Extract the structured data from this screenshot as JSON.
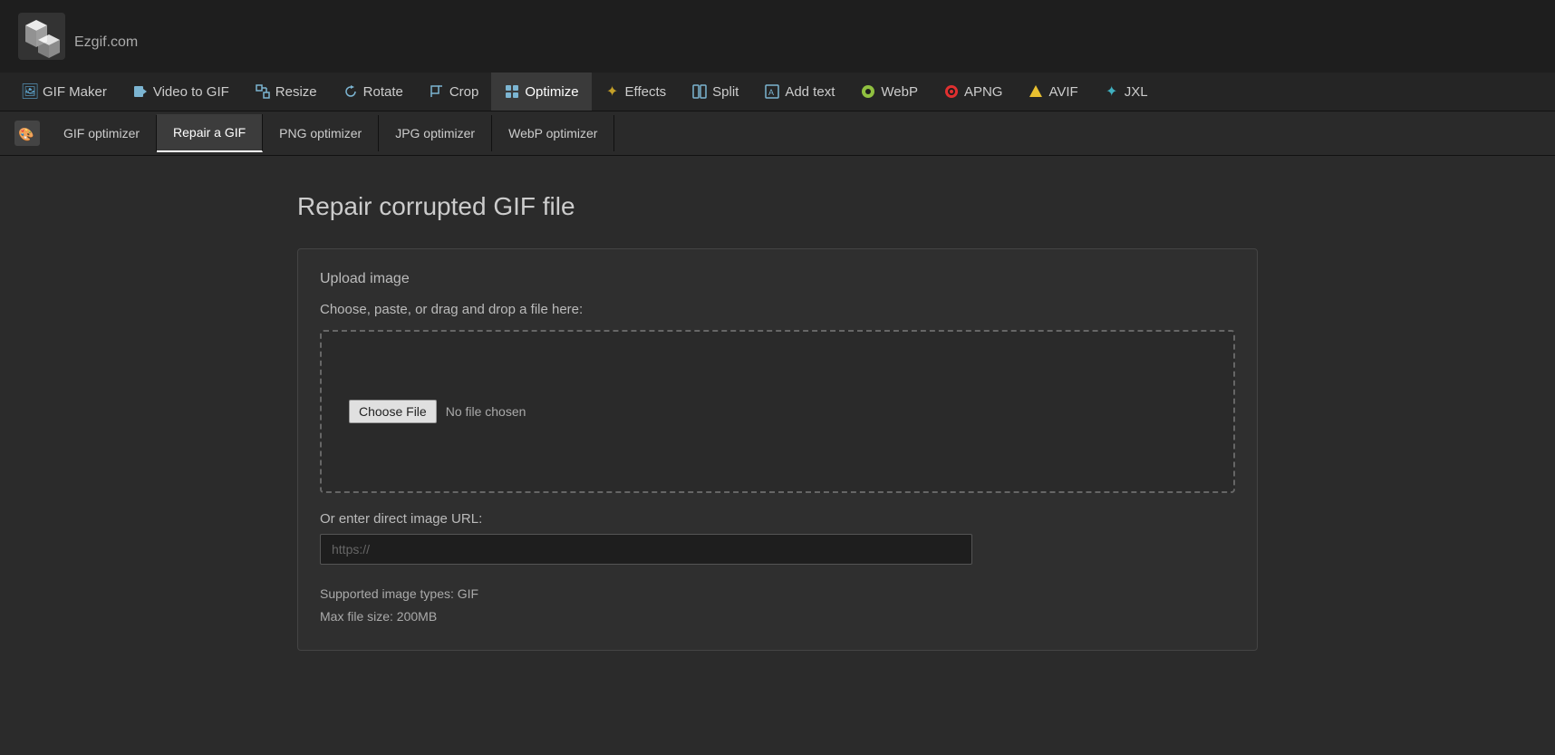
{
  "logo": {
    "text": "Ezgif",
    "suffix": ".com"
  },
  "nav": {
    "items": [
      {
        "id": "gif-maker",
        "label": "GIF Maker",
        "icon": "🖼",
        "active": false
      },
      {
        "id": "video-to-gif",
        "label": "Video to GIF",
        "icon": "🎬",
        "active": false
      },
      {
        "id": "resize",
        "label": "Resize",
        "icon": "⊞",
        "active": false
      },
      {
        "id": "rotate",
        "label": "Rotate",
        "icon": "↻",
        "active": false
      },
      {
        "id": "crop",
        "label": "Crop",
        "icon": "⊞",
        "active": false
      },
      {
        "id": "optimize",
        "label": "Optimize",
        "icon": "⊞",
        "active": true
      },
      {
        "id": "effects",
        "label": "Effects",
        "icon": "✦",
        "active": false
      },
      {
        "id": "split",
        "label": "Split",
        "icon": "⊞",
        "active": false
      },
      {
        "id": "add-text",
        "label": "Add text",
        "icon": "⊞",
        "active": false
      },
      {
        "id": "webp",
        "label": "WebP",
        "icon": "◉",
        "active": false
      },
      {
        "id": "apng",
        "label": "APNG",
        "icon": "⊙",
        "active": false
      },
      {
        "id": "avif",
        "label": "AVIF",
        "icon": "▲",
        "active": false
      },
      {
        "id": "jxl",
        "label": "JXL",
        "icon": "✦",
        "active": false
      }
    ]
  },
  "sub_nav": {
    "items": [
      {
        "id": "gif-optimizer",
        "label": "GIF optimizer",
        "active": false
      },
      {
        "id": "repair-gif",
        "label": "Repair a GIF",
        "active": true
      },
      {
        "id": "png-optimizer",
        "label": "PNG optimizer",
        "active": false
      },
      {
        "id": "jpg-optimizer",
        "label": "JPG optimizer",
        "active": false
      },
      {
        "id": "webp-optimizer",
        "label": "WebP optimizer",
        "active": false
      }
    ]
  },
  "page": {
    "title": "Repair corrupted GIF file"
  },
  "upload_card": {
    "title": "Upload image",
    "description": "Choose, paste, or drag and drop a file here:",
    "choose_file_label": "Choose File",
    "no_file_text": "No file chosen",
    "url_label": "Or enter direct image URL:",
    "url_placeholder": "https://",
    "supported_types": "Supported image types: GIF",
    "max_size": "Max file size: 200MB"
  }
}
